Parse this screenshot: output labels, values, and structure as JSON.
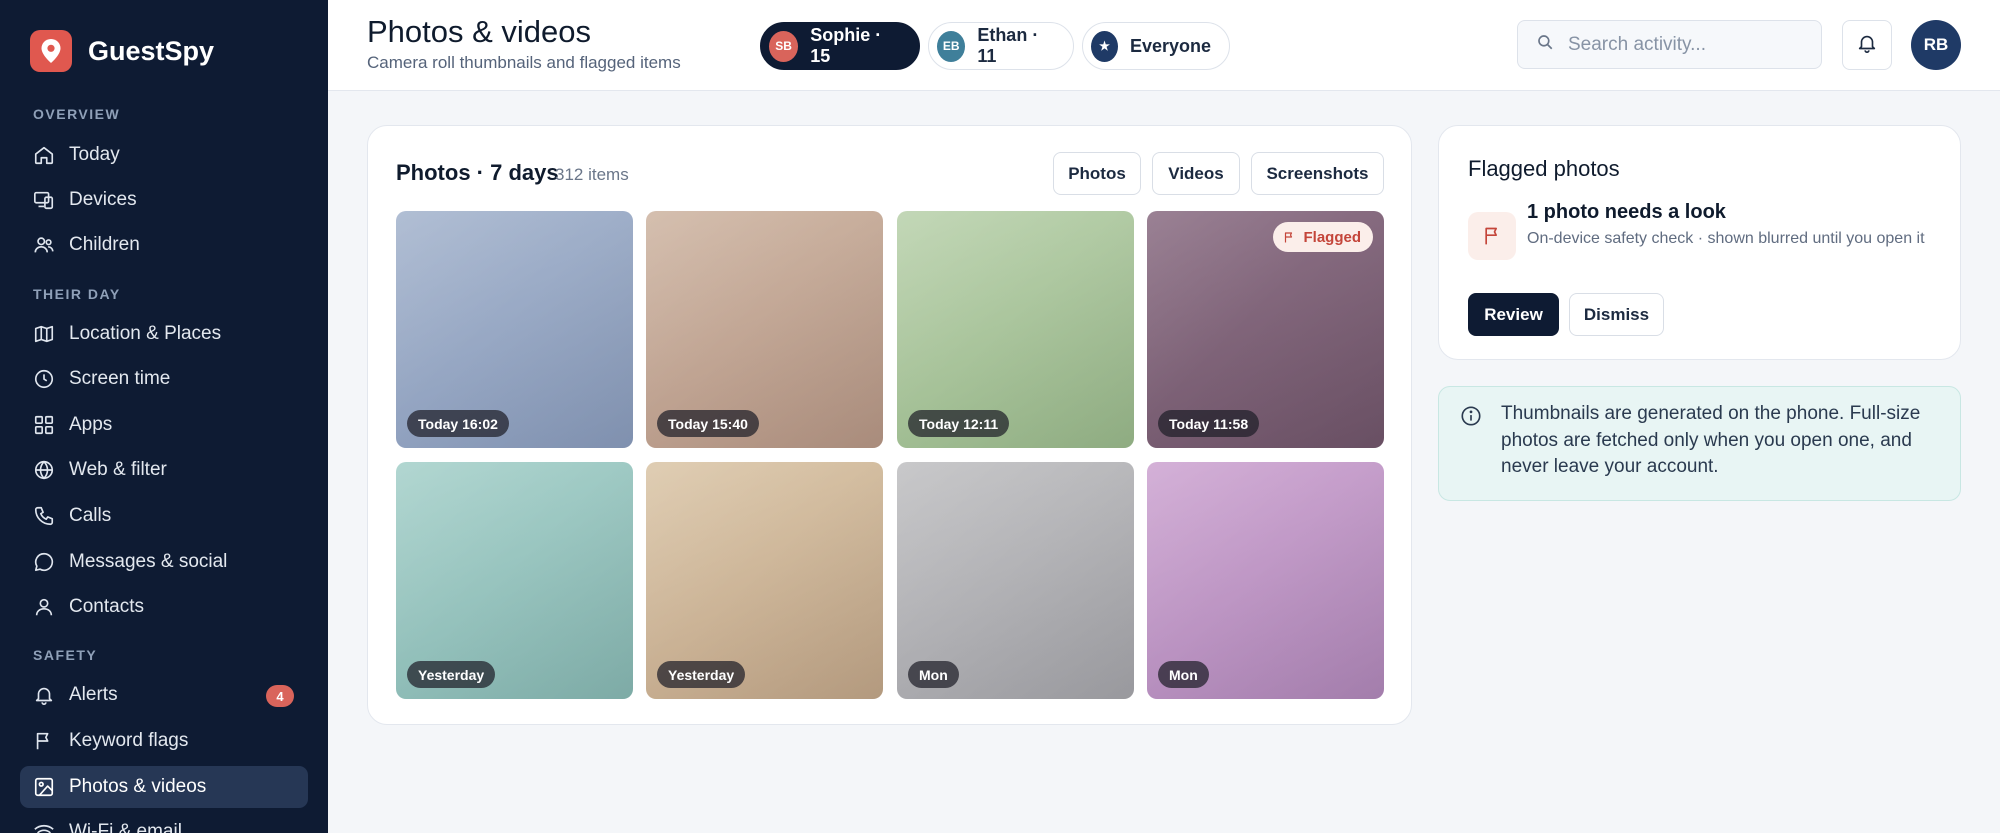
{
  "app": {
    "name": "GuestSpy"
  },
  "sidebar": {
    "sections": [
      {
        "label": "OVERVIEW"
      },
      {
        "label": "THEIR DAY"
      },
      {
        "label": "SAFETY"
      }
    ],
    "items": [
      {
        "label": "Today",
        "icon": "home-icon"
      },
      {
        "label": "Devices",
        "icon": "devices-icon"
      },
      {
        "label": "Children",
        "icon": "users-icon"
      },
      {
        "label": "Location & Places",
        "icon": "map-icon"
      },
      {
        "label": "Screen time",
        "icon": "clock-icon"
      },
      {
        "label": "Apps",
        "icon": "grid-icon"
      },
      {
        "label": "Web & filter",
        "icon": "globe-icon"
      },
      {
        "label": "Calls",
        "icon": "phone-icon"
      },
      {
        "label": "Messages & social",
        "icon": "chat-icon"
      },
      {
        "label": "Contacts",
        "icon": "user-icon"
      },
      {
        "label": "Alerts",
        "icon": "bell-icon",
        "badge": "4"
      },
      {
        "label": "Keyword flags",
        "icon": "flag-icon"
      },
      {
        "label": "Photos & videos",
        "icon": "image-icon",
        "active": true
      },
      {
        "label": "Wi-Fi & email",
        "icon": "wifi-icon"
      }
    ]
  },
  "header": {
    "title": "Photos & videos",
    "subtitle": "Camera roll thumbnails and flagged items",
    "children": [
      {
        "initials": "SB",
        "label": "Sophie · 15",
        "color": "#d9645b",
        "active": true
      },
      {
        "initials": "EB",
        "label": "Ethan · 11",
        "color": "#3f7f9a",
        "active": false
      },
      {
        "initials": "★",
        "label": "Everyone",
        "color": "#1f3a66",
        "active": false
      }
    ],
    "search": {
      "placeholder": "Search activity..."
    },
    "user_initials": "RB"
  },
  "photos": {
    "title": "Photos · 7 days",
    "count": "312 items",
    "filters": [
      "Photos",
      "Videos",
      "Screenshots"
    ],
    "items": [
      {
        "label": "Today 16:02",
        "color_a": "#a8b7cf",
        "color_b": "#8799b9"
      },
      {
        "label": "Today 15:40",
        "color_a": "#d0b8a6",
        "color_b": "#b39483"
      },
      {
        "label": "Today 12:11",
        "color_a": "#bcd3af",
        "color_b": "#97b689"
      },
      {
        "label": "Today 11:58",
        "color_a": "#8f7388",
        "color_b": "#6f5469",
        "flag": "Flagged"
      },
      {
        "label": "Yesterday",
        "color_a": "#a9d2cc",
        "color_b": "#85b5b0"
      },
      {
        "label": "Yesterday",
        "color_a": "#dcc8ab",
        "color_b": "#bea386"
      },
      {
        "label": "Mon",
        "color_a": "#c2c2c4",
        "color_b": "#a2a2a7"
      },
      {
        "label": "Mon",
        "color_a": "#cfa8d3",
        "color_b": "#ad85b6"
      }
    ]
  },
  "flagged": {
    "title": "Flagged photos",
    "headline": "1 photo needs a look",
    "description": "On-device safety check · shown blurred until you open it",
    "review_label": "Review",
    "dismiss_label": "Dismiss"
  },
  "info": {
    "text": "Thumbnails are generated on the phone. Full-size photos are fetched only when you open one, and never leave your account."
  }
}
